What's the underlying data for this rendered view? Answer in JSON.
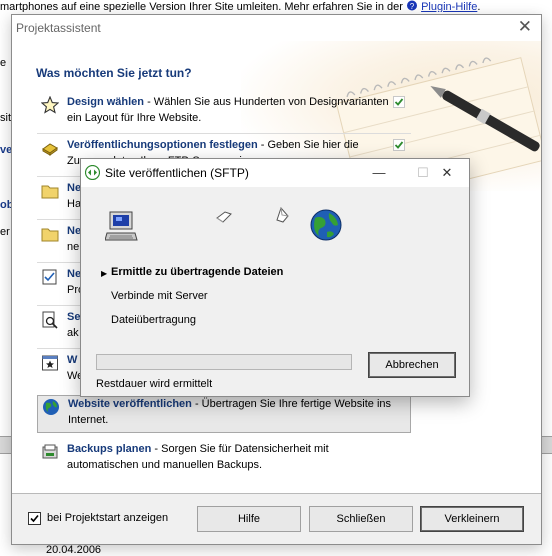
{
  "background": {
    "top_text": "martphones auf eine spezielle Version Ihrer Site umleiten. Mehr erfahren Sie in der",
    "top_link": "Plugin-Hilfe",
    "top_tail": ".",
    "left_fragments": [
      "e",
      "site",
      "ve",
      "obr",
      "er"
    ],
    "date": "20.04.2006"
  },
  "wizard": {
    "title": "Projektassistent",
    "close_glyph": "✕",
    "heading": "Was möchten Sie jetzt tun?",
    "tasks": [
      {
        "name": "Design wählen",
        "desc": " - Wählen Sie aus Hunderten von Designvarianten ein Layout für Ihre Website.",
        "icon": "star-icon",
        "done": true
      },
      {
        "name": "Veröffentlichungsoptionen festlegen",
        "desc": " - Geben Sie hier die Zugangsdaten Ihres FTP-Servers ein.",
        "icon": "ftp-key-icon",
        "done": true
      },
      {
        "name": "Ne",
        "desc": "Ha",
        "icon": "folder-icon",
        "done": false
      },
      {
        "name": "Ne",
        "desc": "ne",
        "icon": "folder-icon",
        "done": false
      },
      {
        "name": "Ne",
        "desc": "Pro",
        "icon": "checklist-icon",
        "done": false
      },
      {
        "name": "Se",
        "desc": "ak",
        "icon": "search-page-icon",
        "done": false
      },
      {
        "name": "W",
        "desc": "We",
        "icon": "window-star-icon",
        "done": false
      },
      {
        "name": "Website veröffentlichen",
        "desc": " - Übertragen Sie Ihre fertige Website ins Internet.",
        "icon": "globe-icon",
        "done": false
      },
      {
        "name": "Backups planen",
        "desc": " - Sorgen Sie für Datensicherheit mit automatischen und manuellen Backups.",
        "icon": "backup-icon",
        "done": false
      }
    ],
    "footer": {
      "show_on_start_label": "bei Projektstart anzeigen",
      "show_on_start_checked": true,
      "help_label": "Hilfe",
      "close_label": "Schließen",
      "minimize_label": "Verkleinern"
    }
  },
  "dialog": {
    "title": "Site veröffentlichen (SFTP)",
    "minimize_glyph": "—",
    "maximize_glyph": "☐",
    "close_glyph": "✕",
    "steps": [
      {
        "label": "Ermittle zu übertragende Dateien",
        "active": true
      },
      {
        "label": "Verbinde mit Server",
        "active": false
      },
      {
        "label": "Dateiübertragung",
        "active": false
      }
    ],
    "active_marker": "▶",
    "progress": 0,
    "remaining_label": "Restdauer wird ermittelt",
    "cancel_label": "Abbrechen",
    "colors": {
      "globe_blue": "#1f5fb5",
      "globe_green": "#35a035",
      "check_green": "#2e8b2e",
      "heading_blue": "#173a7a"
    }
  }
}
